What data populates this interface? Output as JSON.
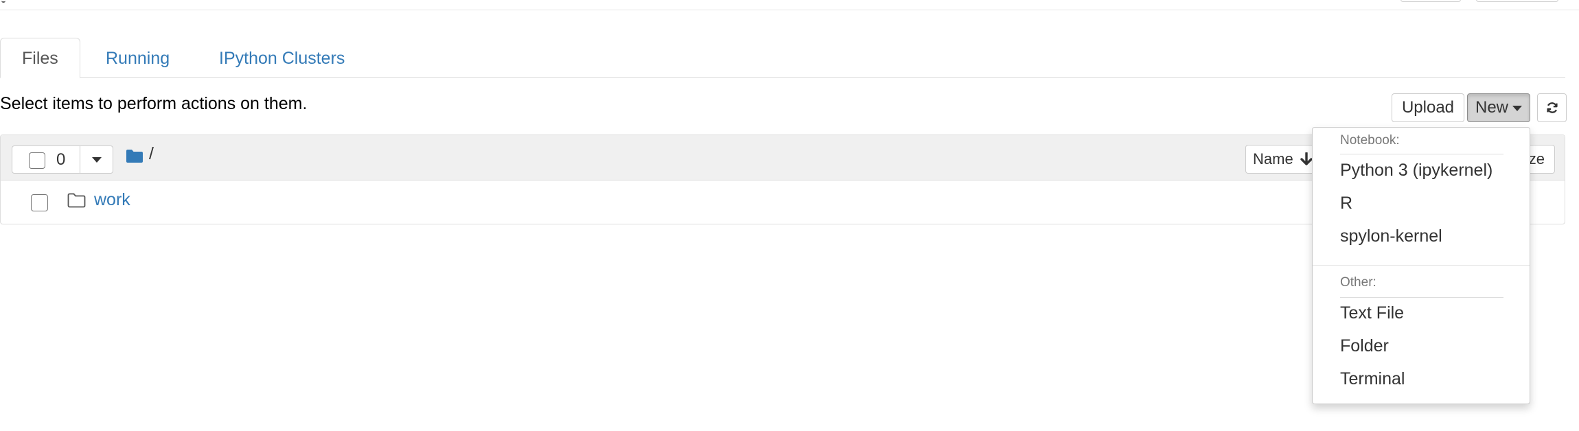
{
  "tabs": [
    {
      "label": "Files",
      "active": true
    },
    {
      "label": "Running",
      "active": false
    },
    {
      "label": "IPython Clusters",
      "active": false
    }
  ],
  "hint": "Select items to perform actions on them.",
  "toolbar": {
    "upload_label": "Upload",
    "new_label": "New"
  },
  "list_header": {
    "selected_count": "0",
    "breadcrumb": "/",
    "name_sort_label": "Name",
    "size_sort_label": "ze"
  },
  "files": [
    {
      "name": "work",
      "type": "folder"
    }
  ],
  "new_menu": {
    "notebook_header": "Notebook:",
    "notebook_items": [
      "Python 3 (ipykernel)",
      "R",
      "spylon-kernel"
    ],
    "other_header": "Other:",
    "other_items": [
      "Text File",
      "Folder",
      "Terminal"
    ]
  },
  "colors": {
    "link": "#337ab7",
    "folder_icon": "#337ab7"
  },
  "icons": [
    "folder-icon",
    "folder-outline-icon",
    "refresh-icon",
    "caret-down-icon",
    "arrow-down-icon"
  ]
}
